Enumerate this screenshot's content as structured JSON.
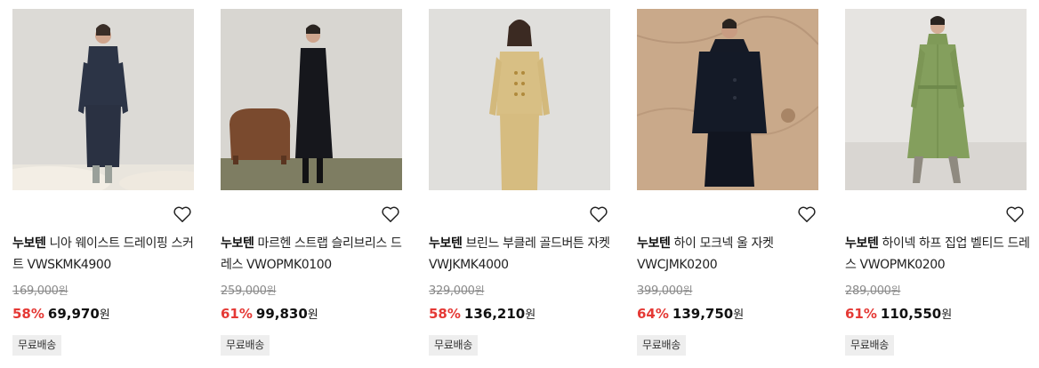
{
  "products": [
    {
      "brand": "누보텐",
      "name": "니아 웨이스트 드레이핑 스커트 VWSKMK4900",
      "original_price": "169,000",
      "discount_rate": "58%",
      "sale_price": "69,970",
      "currency_unit": "원",
      "shipping_badge": "무료배송",
      "image_icon": "product-photo-navy-skirt-set"
    },
    {
      "brand": "누보텐",
      "name": "마르헨 스트랩 슬리브리스 드레스 VWOPMK0100",
      "original_price": "259,000",
      "discount_rate": "61%",
      "sale_price": "99,830",
      "currency_unit": "원",
      "shipping_badge": "무료배송",
      "image_icon": "product-photo-black-sleeveless-dress"
    },
    {
      "brand": "누보텐",
      "name": "브린느 부클레 골드버튼 자켓 VWJKMK4000",
      "original_price": "329,000",
      "discount_rate": "58%",
      "sale_price": "136,210",
      "currency_unit": "원",
      "shipping_badge": "무료배송",
      "image_icon": "product-photo-yellow-boucle-jacket"
    },
    {
      "brand": "누보텐",
      "name": "하이 모크넥 울 자켓 VWCJMK0200",
      "original_price": "399,000",
      "discount_rate": "64%",
      "sale_price": "139,750",
      "currency_unit": "원",
      "shipping_badge": "무료배송",
      "image_icon": "product-photo-navy-wool-jacket"
    },
    {
      "brand": "누보텐",
      "name": "하이넥 하프 집업 벨티드 드레스 VWOPMK0200",
      "original_price": "289,000",
      "discount_rate": "61%",
      "sale_price": "110,550",
      "currency_unit": "원",
      "shipping_badge": "무료배송",
      "image_icon": "product-photo-khaki-belted-dress"
    }
  ],
  "colors": {
    "discount": "#e53935",
    "strike_price": "#8a8a8a",
    "badge_bg": "#eeeeee"
  },
  "icons": {
    "wishlist": "heart-outline-icon"
  }
}
